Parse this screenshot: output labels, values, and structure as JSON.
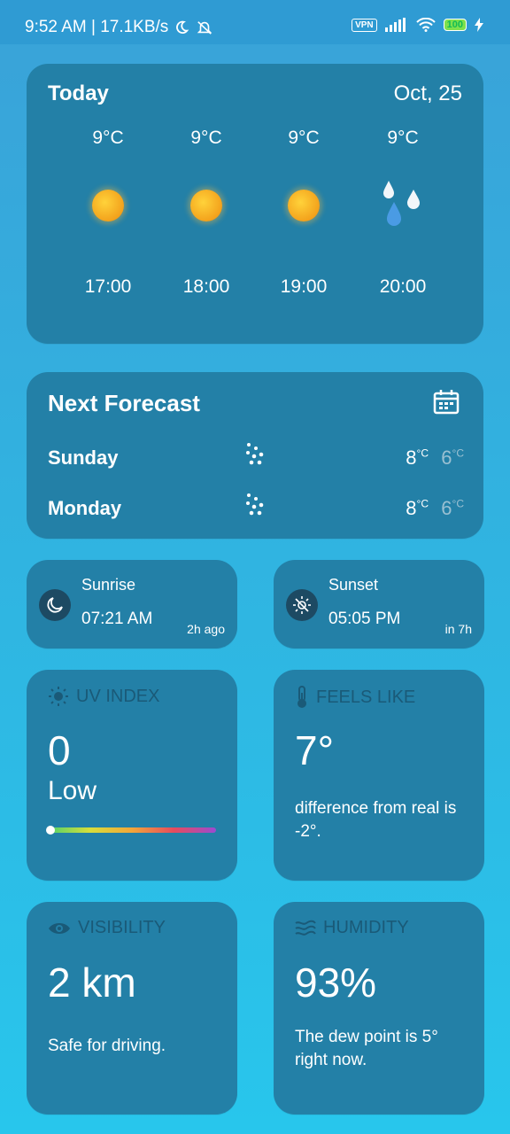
{
  "status_bar": {
    "time_speed": "9:52 AM | 17.1KB/s",
    "vpn": "VPN",
    "battery": "100"
  },
  "today": {
    "title": "Today",
    "date": "Oct, 25",
    "hours": [
      {
        "temp": "9°C",
        "icon": "sun-icon",
        "time": "17:00"
      },
      {
        "temp": "9°C",
        "icon": "sun-icon",
        "time": "18:00"
      },
      {
        "temp": "9°C",
        "icon": "sun-icon",
        "time": "19:00"
      },
      {
        "temp": "9°C",
        "icon": "rain-drops-icon",
        "time": "20:00"
      }
    ]
  },
  "next_forecast": {
    "title": "Next Forecast",
    "days": [
      {
        "day": "Sunday",
        "icon": "rain-icon",
        "high": "8",
        "low": "6",
        "unit": "°C"
      },
      {
        "day": "Monday",
        "icon": "rain-icon",
        "high": "8",
        "low": "6",
        "unit": "°C"
      }
    ]
  },
  "sunrise": {
    "label": "Sunrise",
    "time": "07:21 AM",
    "relative": "2h ago"
  },
  "sunset": {
    "label": "Sunset",
    "time": "05:05 PM",
    "relative": "in 7h"
  },
  "uv": {
    "label": "UV INDEX",
    "value": "0",
    "level": "Low",
    "level_fraction": 0
  },
  "feels_like": {
    "label": "FEELS LIKE",
    "value": "7°",
    "description": "difference from real is -2°."
  },
  "visibility": {
    "label": "VISIBILITY",
    "value": "2 km",
    "description": "Safe for driving."
  },
  "humidity": {
    "label": "HUMIDITY",
    "value": "93%",
    "description": "The dew point is 5° right now."
  }
}
